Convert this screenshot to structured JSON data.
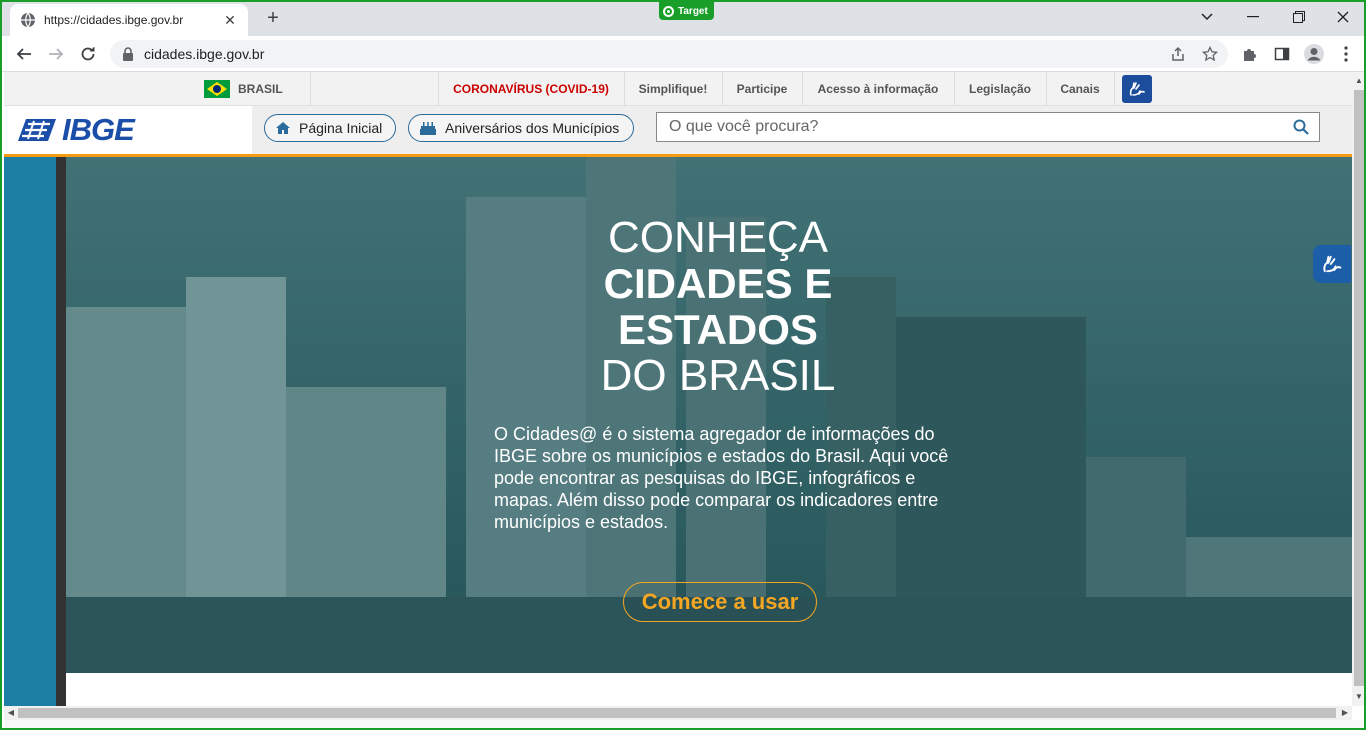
{
  "browser": {
    "tab_title": "https://cidades.ibge.gov.br",
    "url": "cidades.ibge.gov.br",
    "badge": "Target"
  },
  "govbar": {
    "country": "BRASIL",
    "links": [
      "CORONAVÍRUS (COVID-19)",
      "Simplifique!",
      "Participe",
      "Acesso à informação",
      "Legislação",
      "Canais"
    ]
  },
  "header": {
    "logo": "IBGE",
    "home_label": "Página Inicial",
    "anniversaries_label": "Aniversários dos Municípios",
    "search_placeholder": "O que você procura?"
  },
  "hero": {
    "line1": "CONHEÇA",
    "line2": "CIDADES E",
    "line3": "ESTADOS",
    "line4": "DO BRASIL",
    "description": "O Cidades@ é o sistema agregador de informações do IBGE sobre os municípios e estados do Brasil. Aqui você pode encontrar as pesquisas do IBGE, infográficos e mapas. Além disso pode comparar os indicadores entre municípios e estados.",
    "cta": "Comece a usar"
  },
  "colors": {
    "accent_orange": "#f39c12",
    "ibge_blue": "#1b4ea8",
    "covid_red": "#cc0000",
    "frame_green": "#1a9e2a"
  }
}
